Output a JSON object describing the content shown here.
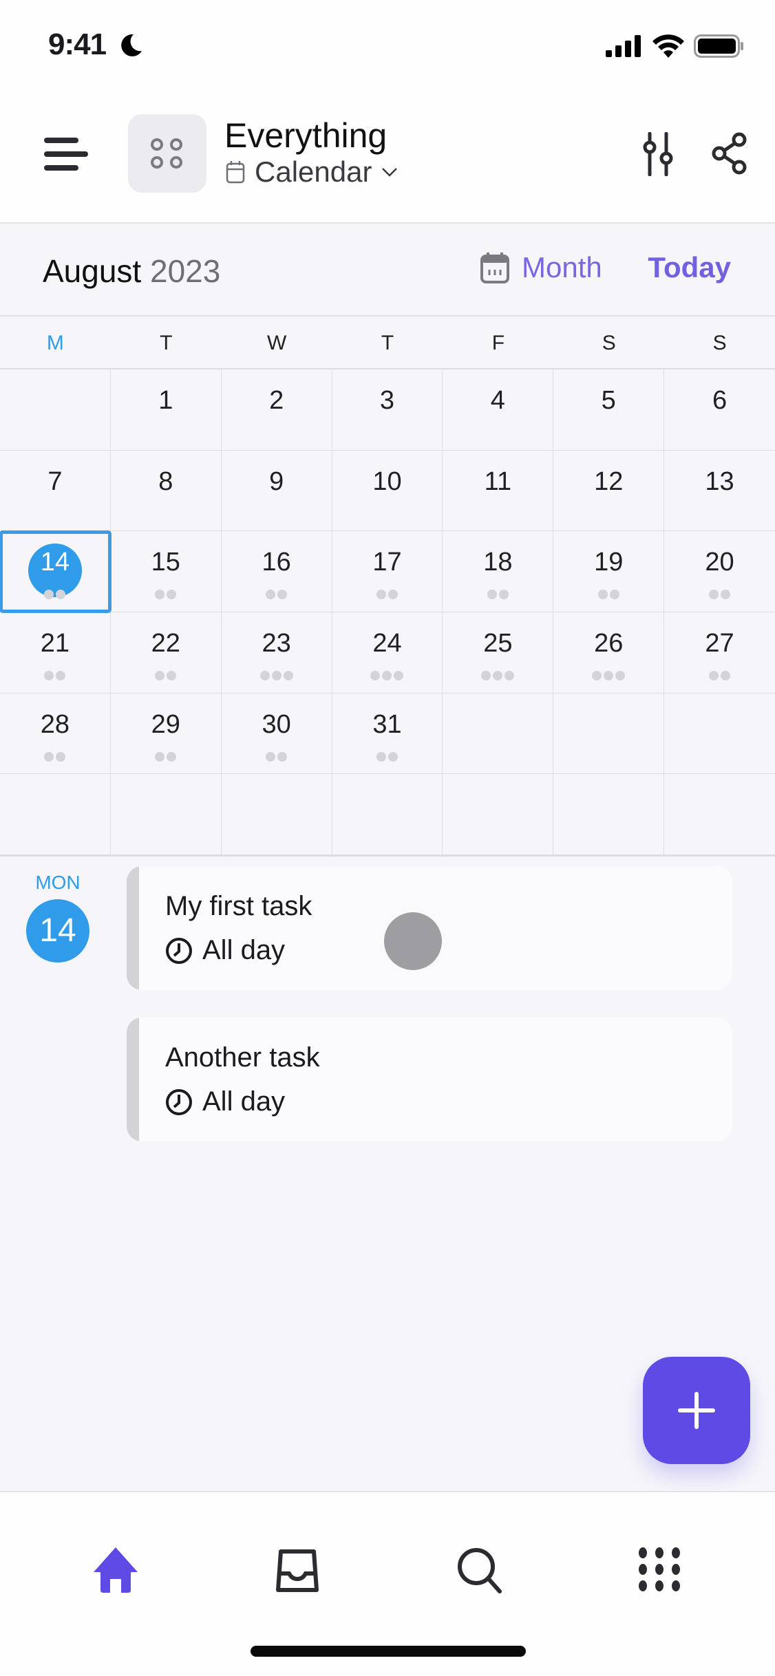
{
  "status_bar": {
    "time": "9:41"
  },
  "header": {
    "title": "Everything",
    "view_name": "Calendar",
    "icons": [
      "menu-icon",
      "space-icon",
      "calendar-icon",
      "chevron-down-icon",
      "sliders-icon",
      "share-icon"
    ]
  },
  "month_bar": {
    "month": "August",
    "year": "2023",
    "view_mode": "Month",
    "today_label": "Today"
  },
  "weekdays": [
    "M",
    "T",
    "W",
    "T",
    "F",
    "S",
    "S"
  ],
  "calendar": {
    "selected_day": "14",
    "cells": [
      {
        "day": "",
        "dots": 0
      },
      {
        "day": "1",
        "dots": 0
      },
      {
        "day": "2",
        "dots": 0
      },
      {
        "day": "3",
        "dots": 0
      },
      {
        "day": "4",
        "dots": 0
      },
      {
        "day": "5",
        "dots": 0
      },
      {
        "day": "6",
        "dots": 0
      },
      {
        "day": "7",
        "dots": 0
      },
      {
        "day": "8",
        "dots": 0
      },
      {
        "day": "9",
        "dots": 0
      },
      {
        "day": "10",
        "dots": 0
      },
      {
        "day": "11",
        "dots": 0
      },
      {
        "day": "12",
        "dots": 0
      },
      {
        "day": "13",
        "dots": 0
      },
      {
        "day": "14",
        "dots": 2
      },
      {
        "day": "15",
        "dots": 2
      },
      {
        "day": "16",
        "dots": 2
      },
      {
        "day": "17",
        "dots": 2
      },
      {
        "day": "18",
        "dots": 2
      },
      {
        "day": "19",
        "dots": 2
      },
      {
        "day": "20",
        "dots": 2
      },
      {
        "day": "21",
        "dots": 2
      },
      {
        "day": "22",
        "dots": 2
      },
      {
        "day": "23",
        "dots": 3
      },
      {
        "day": "24",
        "dots": 3
      },
      {
        "day": "25",
        "dots": 3
      },
      {
        "day": "26",
        "dots": 3
      },
      {
        "day": "27",
        "dots": 2
      },
      {
        "day": "28",
        "dots": 2
      },
      {
        "day": "29",
        "dots": 2
      },
      {
        "day": "30",
        "dots": 2
      },
      {
        "day": "31",
        "dots": 2
      },
      {
        "day": "",
        "dots": 0
      },
      {
        "day": "",
        "dots": 0
      },
      {
        "day": "",
        "dots": 0
      },
      {
        "day": "",
        "dots": 0
      },
      {
        "day": "",
        "dots": 0
      },
      {
        "day": "",
        "dots": 0
      },
      {
        "day": "",
        "dots": 0
      },
      {
        "day": "",
        "dots": 0
      },
      {
        "day": "",
        "dots": 0
      },
      {
        "day": "",
        "dots": 0
      }
    ]
  },
  "agenda": {
    "day_of_week": "MON",
    "day_number": "14",
    "tasks": [
      {
        "name": "My first task",
        "time": "All day"
      },
      {
        "name": "Another task",
        "time": "All day"
      }
    ]
  },
  "fab": {
    "icon": "plus-icon"
  },
  "tab_bar": {
    "tabs": [
      {
        "name": "home",
        "icon": "home-icon",
        "active": true
      },
      {
        "name": "inbox",
        "icon": "inbox-icon",
        "active": false
      },
      {
        "name": "search",
        "icon": "search-icon",
        "active": false
      },
      {
        "name": "more",
        "icon": "grid-icon",
        "active": false
      }
    ]
  },
  "colors": {
    "accent_blue": "#2f9be9",
    "accent_purple": "#5e4be6",
    "link_purple": "#7160df",
    "dot_gray": "#d3d3d8"
  }
}
